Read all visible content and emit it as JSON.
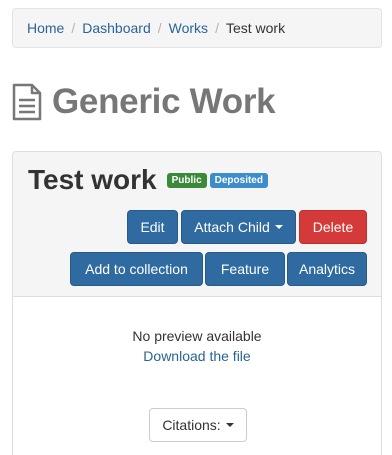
{
  "breadcrumb": {
    "items": [
      "Home",
      "Dashboard",
      "Works"
    ],
    "current": "Test work",
    "separator": "/"
  },
  "page": {
    "title": "Generic Work",
    "icon": "document-icon"
  },
  "work": {
    "title": "Test work",
    "badges": {
      "public": "Public",
      "deposited": "Deposited"
    }
  },
  "actions": {
    "edit": "Edit",
    "attach_child": "Attach Child",
    "delete": "Delete",
    "add_to_collection": "Add to collection",
    "feature": "Feature",
    "analytics": "Analytics"
  },
  "preview": {
    "message": "No preview available",
    "download": "Download the file"
  },
  "citations": {
    "label": "Citations:"
  },
  "colors": {
    "link": "#2a6496",
    "primary": "#2f6aa0",
    "danger": "#d43a3a",
    "badge_public": "#3a8a3a",
    "badge_deposited": "#3c8dc9",
    "title_gray": "#777777"
  }
}
